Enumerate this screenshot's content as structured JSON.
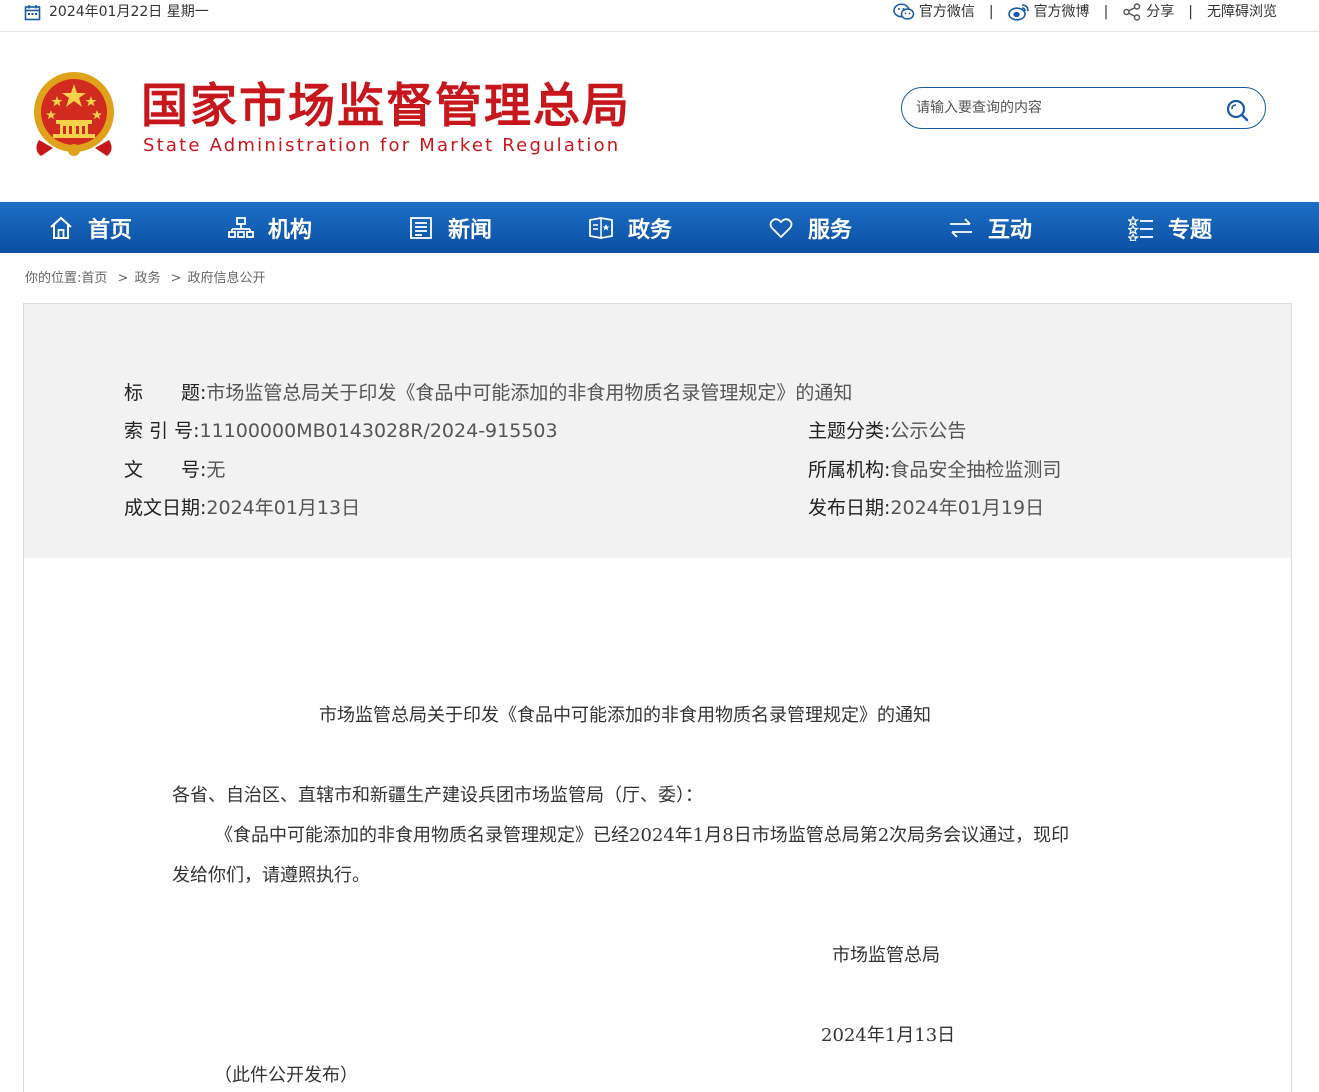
{
  "topbar": {
    "date": "2024年01月22日 星期一",
    "links": {
      "wechat": "官方微信",
      "weibo": "官方微博",
      "share": "分享",
      "accessible": "无障碍浏览"
    }
  },
  "header": {
    "title_cn": "国家市场监督管理总局",
    "title_en": "State Administration for Market Regulation",
    "search_placeholder": "请输入要查询的内容"
  },
  "nav": [
    {
      "label": "首页",
      "icon": "home-icon"
    },
    {
      "label": "机构",
      "icon": "org-chart-icon"
    },
    {
      "label": "新闻",
      "icon": "news-icon"
    },
    {
      "label": "政务",
      "icon": "government-affairs-icon"
    },
    {
      "label": "服务",
      "icon": "heart-icon"
    },
    {
      "label": "互动",
      "icon": "exchange-icon"
    },
    {
      "label": "专题",
      "icon": "topics-icon"
    }
  ],
  "breadcrumb": {
    "prefix": "你的位置:",
    "items": [
      "首页",
      "政务",
      "政府信息公开"
    ],
    "sep": ">"
  },
  "meta": {
    "title_label": "标　　题:",
    "title_value": "市场监管总局关于印发《食品中可能添加的非食用物质名录管理规定》的通知",
    "index_label": "索 引 号:",
    "index_value": "11100000MB0143028R/2024-915503",
    "category_label": "主题分类:",
    "category_value": "公示公告",
    "docno_label": "文　　号:",
    "docno_value": "无",
    "org_label": "所属机构:",
    "org_value": "食品安全抽检监测司",
    "written_label": "成文日期:",
    "written_value": "2024年01月13日",
    "published_label": "发布日期:",
    "published_value": "2024年01月19日"
  },
  "document": {
    "heading": "市场监管总局关于印发《食品中可能添加的非食用物质名录管理规定》的通知",
    "salutation": "各省、自治区、直辖市和新疆生产建设兵团市场监管局（厅、委）：",
    "para_line1": "《食品中可能添加的非食用物质名录管理规定》已经2024年1月8日市场监管总局第2次局务会议通过，现印",
    "para_line2": "发给你们，请遵照执行。",
    "signature": "市场监管总局",
    "date": "2024年1月13日",
    "note": "（此件公开发布）"
  },
  "colors": {
    "brand_red": "#c8161d",
    "nav_blue": "#0b4fa3",
    "search_border": "#1a5aa8"
  }
}
